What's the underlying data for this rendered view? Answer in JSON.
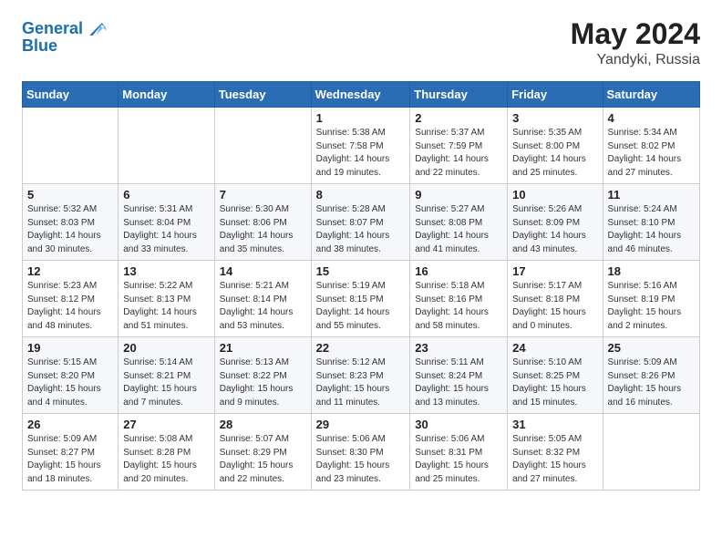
{
  "header": {
    "logo_line1": "General",
    "logo_line2": "Blue",
    "month_year": "May 2024",
    "location": "Yandyki, Russia"
  },
  "days_of_week": [
    "Sunday",
    "Monday",
    "Tuesday",
    "Wednesday",
    "Thursday",
    "Friday",
    "Saturday"
  ],
  "weeks": [
    [
      {
        "day": "",
        "sunrise": "",
        "sunset": "",
        "daylight": ""
      },
      {
        "day": "",
        "sunrise": "",
        "sunset": "",
        "daylight": ""
      },
      {
        "day": "",
        "sunrise": "",
        "sunset": "",
        "daylight": ""
      },
      {
        "day": "1",
        "sunrise": "Sunrise: 5:38 AM",
        "sunset": "Sunset: 7:58 PM",
        "daylight": "Daylight: 14 hours and 19 minutes."
      },
      {
        "day": "2",
        "sunrise": "Sunrise: 5:37 AM",
        "sunset": "Sunset: 7:59 PM",
        "daylight": "Daylight: 14 hours and 22 minutes."
      },
      {
        "day": "3",
        "sunrise": "Sunrise: 5:35 AM",
        "sunset": "Sunset: 8:00 PM",
        "daylight": "Daylight: 14 hours and 25 minutes."
      },
      {
        "day": "4",
        "sunrise": "Sunrise: 5:34 AM",
        "sunset": "Sunset: 8:02 PM",
        "daylight": "Daylight: 14 hours and 27 minutes."
      }
    ],
    [
      {
        "day": "5",
        "sunrise": "Sunrise: 5:32 AM",
        "sunset": "Sunset: 8:03 PM",
        "daylight": "Daylight: 14 hours and 30 minutes."
      },
      {
        "day": "6",
        "sunrise": "Sunrise: 5:31 AM",
        "sunset": "Sunset: 8:04 PM",
        "daylight": "Daylight: 14 hours and 33 minutes."
      },
      {
        "day": "7",
        "sunrise": "Sunrise: 5:30 AM",
        "sunset": "Sunset: 8:06 PM",
        "daylight": "Daylight: 14 hours and 35 minutes."
      },
      {
        "day": "8",
        "sunrise": "Sunrise: 5:28 AM",
        "sunset": "Sunset: 8:07 PM",
        "daylight": "Daylight: 14 hours and 38 minutes."
      },
      {
        "day": "9",
        "sunrise": "Sunrise: 5:27 AM",
        "sunset": "Sunset: 8:08 PM",
        "daylight": "Daylight: 14 hours and 41 minutes."
      },
      {
        "day": "10",
        "sunrise": "Sunrise: 5:26 AM",
        "sunset": "Sunset: 8:09 PM",
        "daylight": "Daylight: 14 hours and 43 minutes."
      },
      {
        "day": "11",
        "sunrise": "Sunrise: 5:24 AM",
        "sunset": "Sunset: 8:10 PM",
        "daylight": "Daylight: 14 hours and 46 minutes."
      }
    ],
    [
      {
        "day": "12",
        "sunrise": "Sunrise: 5:23 AM",
        "sunset": "Sunset: 8:12 PM",
        "daylight": "Daylight: 14 hours and 48 minutes."
      },
      {
        "day": "13",
        "sunrise": "Sunrise: 5:22 AM",
        "sunset": "Sunset: 8:13 PM",
        "daylight": "Daylight: 14 hours and 51 minutes."
      },
      {
        "day": "14",
        "sunrise": "Sunrise: 5:21 AM",
        "sunset": "Sunset: 8:14 PM",
        "daylight": "Daylight: 14 hours and 53 minutes."
      },
      {
        "day": "15",
        "sunrise": "Sunrise: 5:19 AM",
        "sunset": "Sunset: 8:15 PM",
        "daylight": "Daylight: 14 hours and 55 minutes."
      },
      {
        "day": "16",
        "sunrise": "Sunrise: 5:18 AM",
        "sunset": "Sunset: 8:16 PM",
        "daylight": "Daylight: 14 hours and 58 minutes."
      },
      {
        "day": "17",
        "sunrise": "Sunrise: 5:17 AM",
        "sunset": "Sunset: 8:18 PM",
        "daylight": "Daylight: 15 hours and 0 minutes."
      },
      {
        "day": "18",
        "sunrise": "Sunrise: 5:16 AM",
        "sunset": "Sunset: 8:19 PM",
        "daylight": "Daylight: 15 hours and 2 minutes."
      }
    ],
    [
      {
        "day": "19",
        "sunrise": "Sunrise: 5:15 AM",
        "sunset": "Sunset: 8:20 PM",
        "daylight": "Daylight: 15 hours and 4 minutes."
      },
      {
        "day": "20",
        "sunrise": "Sunrise: 5:14 AM",
        "sunset": "Sunset: 8:21 PM",
        "daylight": "Daylight: 15 hours and 7 minutes."
      },
      {
        "day": "21",
        "sunrise": "Sunrise: 5:13 AM",
        "sunset": "Sunset: 8:22 PM",
        "daylight": "Daylight: 15 hours and 9 minutes."
      },
      {
        "day": "22",
        "sunrise": "Sunrise: 5:12 AM",
        "sunset": "Sunset: 8:23 PM",
        "daylight": "Daylight: 15 hours and 11 minutes."
      },
      {
        "day": "23",
        "sunrise": "Sunrise: 5:11 AM",
        "sunset": "Sunset: 8:24 PM",
        "daylight": "Daylight: 15 hours and 13 minutes."
      },
      {
        "day": "24",
        "sunrise": "Sunrise: 5:10 AM",
        "sunset": "Sunset: 8:25 PM",
        "daylight": "Daylight: 15 hours and 15 minutes."
      },
      {
        "day": "25",
        "sunrise": "Sunrise: 5:09 AM",
        "sunset": "Sunset: 8:26 PM",
        "daylight": "Daylight: 15 hours and 16 minutes."
      }
    ],
    [
      {
        "day": "26",
        "sunrise": "Sunrise: 5:09 AM",
        "sunset": "Sunset: 8:27 PM",
        "daylight": "Daylight: 15 hours and 18 minutes."
      },
      {
        "day": "27",
        "sunrise": "Sunrise: 5:08 AM",
        "sunset": "Sunset: 8:28 PM",
        "daylight": "Daylight: 15 hours and 20 minutes."
      },
      {
        "day": "28",
        "sunrise": "Sunrise: 5:07 AM",
        "sunset": "Sunset: 8:29 PM",
        "daylight": "Daylight: 15 hours and 22 minutes."
      },
      {
        "day": "29",
        "sunrise": "Sunrise: 5:06 AM",
        "sunset": "Sunset: 8:30 PM",
        "daylight": "Daylight: 15 hours and 23 minutes."
      },
      {
        "day": "30",
        "sunrise": "Sunrise: 5:06 AM",
        "sunset": "Sunset: 8:31 PM",
        "daylight": "Daylight: 15 hours and 25 minutes."
      },
      {
        "day": "31",
        "sunrise": "Sunrise: 5:05 AM",
        "sunset": "Sunset: 8:32 PM",
        "daylight": "Daylight: 15 hours and 27 minutes."
      },
      {
        "day": "",
        "sunrise": "",
        "sunset": "",
        "daylight": ""
      }
    ]
  ]
}
